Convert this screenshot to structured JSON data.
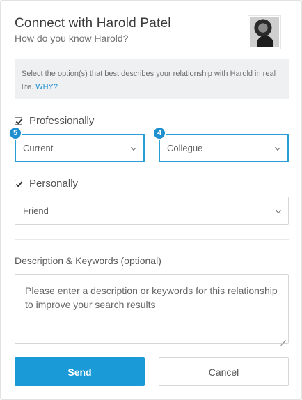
{
  "dialog": {
    "title": "Connect with Harold Patel",
    "subtitle": "How do you know Harold?",
    "avatar_icon": "profile-photo"
  },
  "info": {
    "text": "Select the option(s) that best describes your relationship with Harold in real life. ",
    "link": "WHY?"
  },
  "professionally": {
    "checked": true,
    "label": "Professionally",
    "status_select": {
      "value": "Current",
      "badge": "5"
    },
    "role_select": {
      "value": "Collegue",
      "badge": "4"
    }
  },
  "personally": {
    "checked": true,
    "label": "Personally",
    "select": {
      "value": "Friend"
    }
  },
  "description": {
    "label": "Description & Keywords (optional)",
    "placeholder": "Please enter a description or keywords for this relationship to improve your search results"
  },
  "buttons": {
    "send": "Send",
    "cancel": "Cancel"
  },
  "colors": {
    "accent": "#1a9ad6",
    "focus_border": "#2a9fd6",
    "info_bg": "#eef0f2"
  }
}
